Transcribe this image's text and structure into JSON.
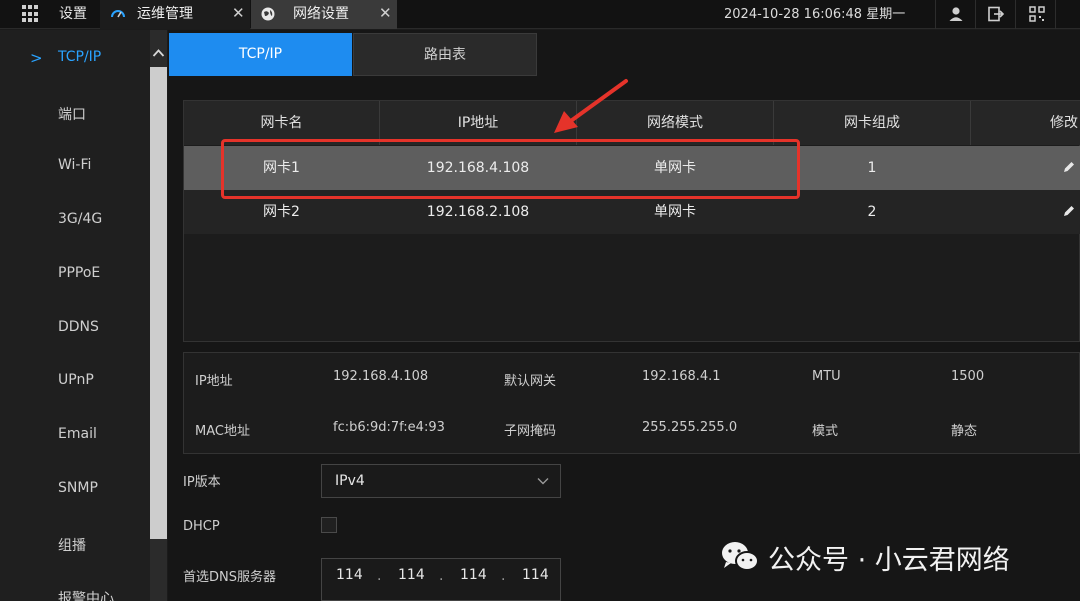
{
  "topbar": {
    "settings_label": "设置",
    "ops_tab_label": "运维管理",
    "network_tab_label": "网络设置",
    "close_glyph": "✕",
    "datetime": "2024-10-28 16:06:48 星期一",
    "icons": [
      "apps-grid-icon",
      "gauge-icon",
      "globe-icon",
      "user-icon",
      "logout-icon",
      "qr-code-icon"
    ]
  },
  "sidebar": {
    "items": [
      {
        "label": "TCP/IP",
        "active": true
      },
      {
        "label": "端口"
      },
      {
        "label": "Wi-Fi"
      },
      {
        "label": "3G/4G"
      },
      {
        "label": "PPPoE"
      },
      {
        "label": "DDNS"
      },
      {
        "label": "UPnP"
      },
      {
        "label": "Email"
      },
      {
        "label": "SNMP"
      },
      {
        "label": "组播"
      },
      {
        "label": "报警中心"
      }
    ]
  },
  "subtabs": {
    "tcpip": "TCP/IP",
    "route": "路由表"
  },
  "nic_table": {
    "headers": [
      "网卡名",
      "IP地址",
      "网络模式",
      "网卡组成",
      "修改"
    ],
    "rows": [
      {
        "name": "网卡1",
        "ip": "192.168.4.108",
        "mode": "单网卡",
        "group": "1"
      },
      {
        "name": "网卡2",
        "ip": "192.168.2.108",
        "mode": "单网卡",
        "group": "2"
      }
    ]
  },
  "info": {
    "ip_label": "IP地址",
    "ip_value": "192.168.4.108",
    "gateway_label": "默认网关",
    "gateway_value": "192.168.4.1",
    "mtu_label": "MTU",
    "mtu_value": "1500",
    "mac_label": "MAC地址",
    "mac_value": "fc:b6:9d:7f:e4:93",
    "mask_label": "子网掩码",
    "mask_value": "255.255.255.0",
    "mode_label": "模式",
    "mode_value": "静态"
  },
  "form": {
    "ip_version_label": "IP版本",
    "ip_version_value": "IPv4",
    "dhcp_label": "DHCP",
    "dhcp_checked": false,
    "dns_label": "首选DNS服务器",
    "dns_segments": [
      "114",
      "114",
      "114",
      "114"
    ]
  },
  "watermark": {
    "text": "公众号 · 小云君网络"
  },
  "colors": {
    "accent": "#1e8cf0",
    "annotation": "#e5332a",
    "selected_row": "#5e5e5e"
  }
}
